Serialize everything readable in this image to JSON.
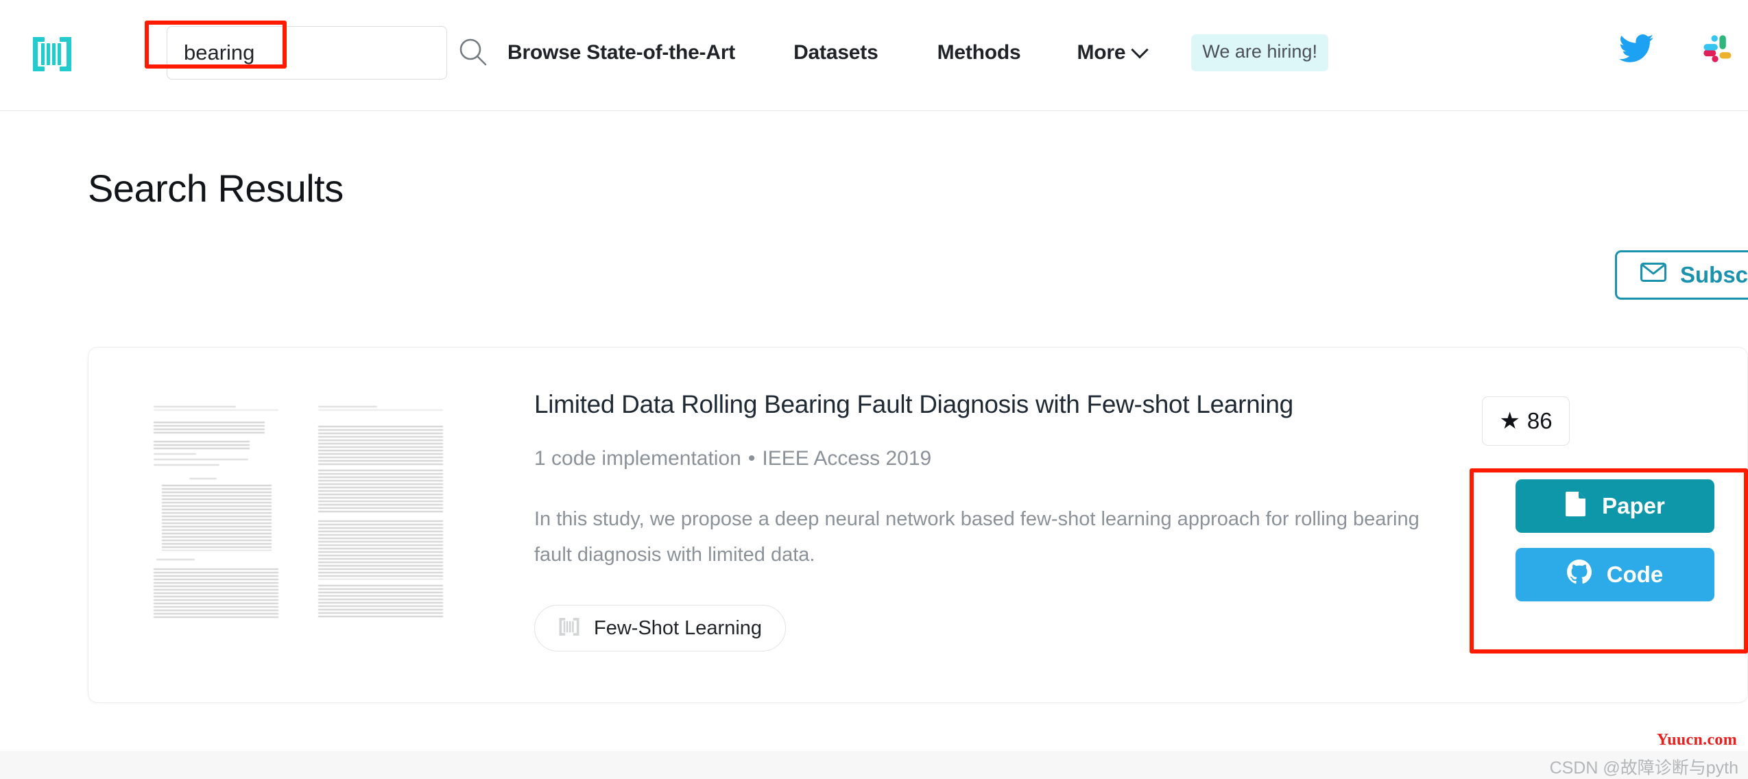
{
  "header": {
    "logo_icon": "paperswithcode-barcode-icon",
    "search": {
      "value": "bearing",
      "placeholder": "Search",
      "icon": "search-icon"
    },
    "nav": [
      {
        "label": "Browse State-of-the-Art",
        "has_chevron": false
      },
      {
        "label": "Datasets",
        "has_chevron": false
      },
      {
        "label": "Methods",
        "has_chevron": false
      },
      {
        "label": "More",
        "has_chevron": true,
        "chevron_icon": "chevron-down-icon"
      }
    ],
    "hiring_badge": {
      "label": "We are hiring!",
      "bg_color": "#ddf6f8",
      "text_color": "#4a5054"
    },
    "social": [
      {
        "name": "twitter-icon",
        "color": "#1da1f2"
      },
      {
        "name": "slack-icon",
        "colors": [
          "#36c5f0",
          "#2eb67d",
          "#e01e5a",
          "#ecb22e"
        ]
      }
    ]
  },
  "main": {
    "page_title": "Search Results",
    "subscribe_button": {
      "label": "Subscribe",
      "icon": "envelope-icon",
      "color": "#1a92ad"
    },
    "results": [
      {
        "title": "Limited Data Rolling Bearing Fault Diagnosis with Few-shot Learning",
        "meta_implementations": "1 code implementation",
        "meta_separator": "•",
        "meta_venue": "IEEE Access 2019",
        "abstract": "In this study, we propose a deep neural network based few-shot learning approach for rolling bearing fault diagnosis with limited data.",
        "tag": {
          "label": "Few-Shot Learning",
          "icon": "paperswithcode-barcode-icon"
        },
        "stars": {
          "icon": "star-icon",
          "count": "86"
        },
        "actions": [
          {
            "label": "Paper",
            "icon": "document-icon",
            "color": "#0d97a8"
          },
          {
            "label": "Code",
            "icon": "github-icon",
            "color": "#2cabe8"
          }
        ]
      }
    ]
  },
  "annotations": {
    "color": "#ff1a00",
    "regions": [
      "search-input-highlight",
      "action-buttons-highlight"
    ]
  },
  "watermarks": {
    "red": "Yuucn.com",
    "grey": "CSDN @故障诊断与pyth"
  }
}
